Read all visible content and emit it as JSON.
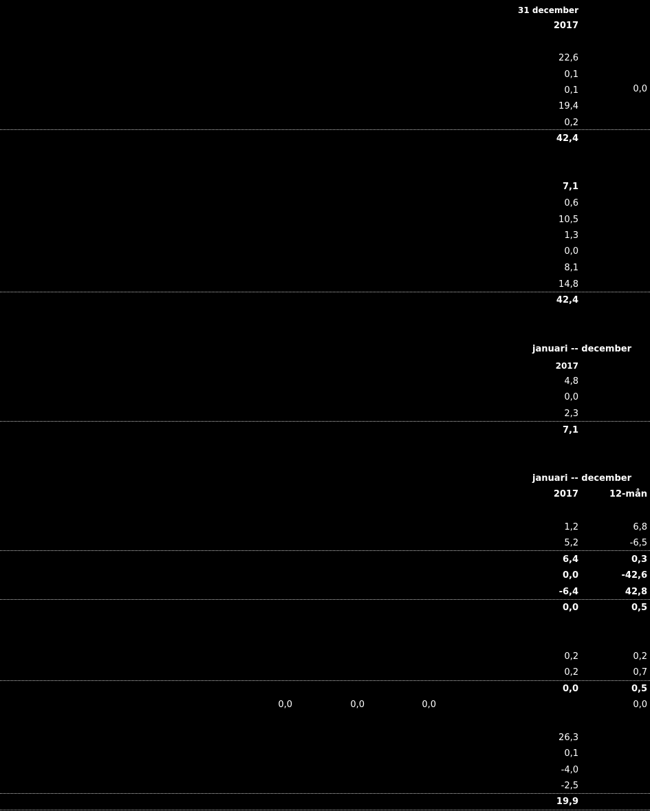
{
  "sections": [
    {
      "id": "balance",
      "header_period": "31 december",
      "header_year": "2017",
      "assets": [
        "22,6",
        "0,1",
        "0,1",
        "19,4",
        "0,2"
      ],
      "asset_side_value": "0,0",
      "assets_total": "42,4",
      "liabilities_first": "7,1",
      "liabilities": [
        "0,6",
        "10,5",
        "1,3",
        "0,0",
        "8,1",
        "14,8"
      ],
      "liabilities_total": "42,4"
    },
    {
      "id": "equity",
      "header_period": "januari -- december",
      "header_year": "2017",
      "rows": [
        "4,8",
        "0,0",
        "2,3"
      ],
      "total": "7,1"
    },
    {
      "id": "cashflow",
      "header_period": "januari -- december",
      "header_year": "2017",
      "header_col2": "12-mån",
      "rows_a": [
        [
          "1,2",
          "6,8"
        ],
        [
          "5,2",
          "-6,5"
        ]
      ],
      "subtotal_a": [
        [
          "6,4",
          "0,3"
        ],
        [
          "0,0",
          "-42,6"
        ],
        [
          "-6,4",
          "42,8"
        ]
      ],
      "total_a": [
        "0,0",
        "0,5"
      ],
      "rows_b": [
        [
          "0,2",
          "0,2"
        ],
        [
          "0,2",
          "0,7"
        ]
      ],
      "total_b": [
        "0,0",
        "0,5"
      ],
      "side_values": [
        "0,0",
        "0,0",
        "0,0"
      ],
      "side_right": "0,0",
      "rows_c": [
        "26,3",
        "0,1",
        "-4,0",
        "-2,5"
      ],
      "total_c": "19,9"
    }
  ]
}
